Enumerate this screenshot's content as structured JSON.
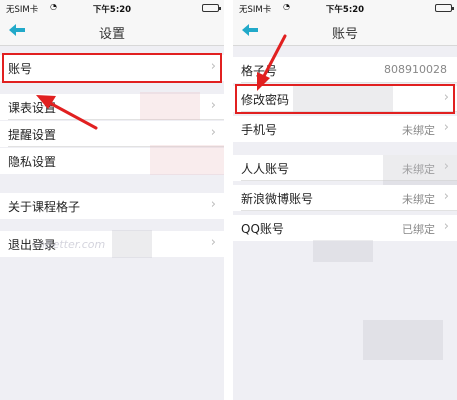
{
  "status_bar": {
    "carrier": "无SIM卡",
    "time": "下午5:20"
  },
  "left": {
    "title": "设置",
    "items": [
      {
        "label": "账号"
      },
      {
        "label": "课表设置"
      },
      {
        "label": "提醒设置"
      },
      {
        "label": "隐私设置"
      },
      {
        "label": "关于课程格子"
      },
      {
        "label": "退出登录"
      }
    ]
  },
  "right": {
    "title": "账号",
    "items": [
      {
        "label": "格子号",
        "value": "808910028"
      },
      {
        "label": "修改密码",
        "value": ""
      },
      {
        "label": "手机号",
        "value": "未绑定"
      },
      {
        "label": "人人账号",
        "value": "未绑定"
      },
      {
        "label": "新浪微博账号",
        "value": "未绑定"
      },
      {
        "label": "QQ账号",
        "value": "已绑定"
      }
    ]
  },
  "watermark": "cnBetter.com",
  "colors": {
    "accent": "#21a9c9",
    "highlight": "#e12020",
    "background": "#efeff4"
  },
  "icons": [
    "back-arrow-icon",
    "chevron-right-icon",
    "wifi-icon",
    "battery-icon"
  ]
}
